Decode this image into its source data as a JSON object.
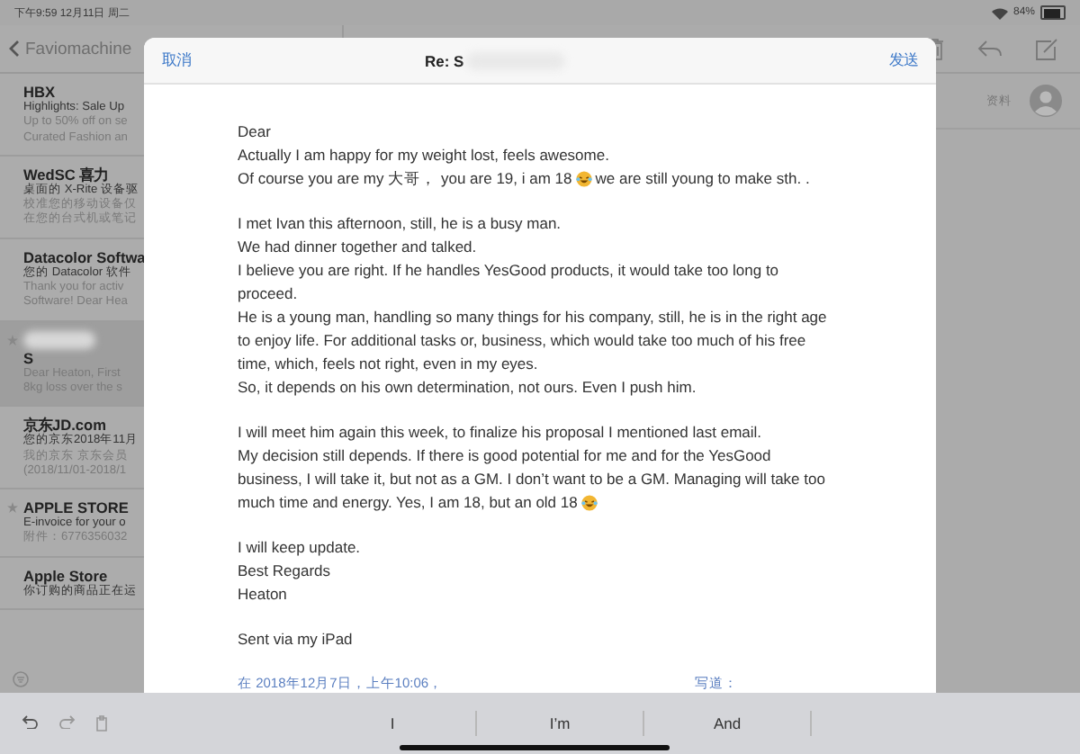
{
  "status_bar": {
    "time": "下午9:59  12月11日 周二",
    "battery": "84%"
  },
  "mailbox": {
    "back_label": "Faviomachine",
    "messages": [
      {
        "sender": "HBX",
        "subject": "Highlights: Sale Up",
        "preview": [
          "Up to 50% off on se",
          "Curated Fashion an"
        ],
        "selected": false,
        "flagged": false
      },
      {
        "sender": "WedSC 喜力",
        "subject": "桌面的 X-Rite 设备驱",
        "preview": [
          "校准您的移动设备仅",
          "在您的台式机或笔记"
        ],
        "selected": false,
        "flagged": false
      },
      {
        "sender": "Datacolor Softwa",
        "subject": "您的 Datacolor 软件",
        "preview": [
          "Thank you for activ",
          "Software! Dear Hea"
        ],
        "selected": false,
        "flagged": false
      },
      {
        "sender": "S",
        "preview": [
          "Dear Heaton, First",
          "8kg loss over the s"
        ],
        "selected": true,
        "flagged": true
      },
      {
        "sender": "京东JD.com",
        "subject": "您的京东2018年11月",
        "preview": [
          "我的京东 京东会员",
          "(2018/11/01-2018/1"
        ],
        "selected": false,
        "flagged": false
      },
      {
        "sender": "APPLE STORE",
        "subject": "E-invoice for your o",
        "preview": [
          "附件：6776356032"
        ],
        "selected": false,
        "flagged": true
      },
      {
        "sender": "Apple Store",
        "subject": "你订购的商品正在运",
        "selected": false,
        "flagged": false
      }
    ]
  },
  "detail": {
    "contact_label": "资料"
  },
  "compose": {
    "cancel": "取消",
    "title": "Re: S",
    "send": "发送",
    "body": [
      {
        "kind": "text",
        "parts": [
          "Dear"
        ]
      },
      {
        "kind": "text",
        "parts": [
          "Actually I am happy for my weight lost, feels awesome."
        ]
      },
      {
        "kind": "text",
        "parts": [
          "Of course you are my 大哥，  you are 19, i am 18",
          {
            "kind": "emoji"
          },
          "we are still young to make sth. ."
        ]
      },
      {
        "kind": "gap"
      },
      {
        "kind": "text",
        "parts": [
          "I met Ivan this afternoon, still, he is a busy man."
        ]
      },
      {
        "kind": "text",
        "parts": [
          "We had dinner together and talked."
        ]
      },
      {
        "kind": "text",
        "parts": [
          "I believe you are right. If he handles YesGood products, it would take too long to"
        ]
      },
      {
        "kind": "text",
        "parts": [
          "proceed."
        ]
      },
      {
        "kind": "text",
        "parts": [
          "He is a young man, handling so many things for his company, still, he is in the right age"
        ]
      },
      {
        "kind": "text",
        "parts": [
          "to enjoy life. For additional tasks or, business, which would take too much of his free"
        ]
      },
      {
        "kind": "text",
        "parts": [
          "time, which, feels not right, even in my eyes."
        ]
      },
      {
        "kind": "text",
        "parts": [
          "So, it depends on his own determination, not ours. Even I push him."
        ]
      },
      {
        "kind": "gap"
      },
      {
        "kind": "text",
        "parts": [
          "I will meet him again this week, to finalize his proposal I mentioned last email."
        ]
      },
      {
        "kind": "text",
        "parts": [
          "My decision still depends. If there is good potential for me and for the YesGood"
        ]
      },
      {
        "kind": "text",
        "parts": [
          "business, I will take it, but not as a GM. I don’t want to be a GM. Managing will take too"
        ]
      },
      {
        "kind": "text",
        "parts": [
          "much time and energy. Yes, I am 18, but  an old 18",
          {
            "kind": "emoji"
          }
        ]
      },
      {
        "kind": "gap"
      },
      {
        "kind": "text",
        "parts": [
          "I will keep update."
        ]
      },
      {
        "kind": "text",
        "parts": [
          "Best Regards"
        ]
      },
      {
        "kind": "text",
        "parts": [
          "Heaton"
        ]
      },
      {
        "kind": "gap"
      },
      {
        "kind": "text",
        "parts": [
          "Sent via my  iPad"
        ]
      },
      {
        "kind": "gap"
      }
    ],
    "quote_header": [
      "在 2018年12月7日，上午10:06，",
      "写道："
    ]
  },
  "keyboard": {
    "suggestions": [
      "I",
      "I’m",
      "And"
    ]
  }
}
